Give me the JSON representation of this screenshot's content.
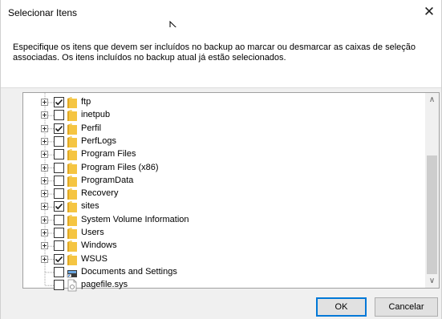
{
  "window": {
    "title": "Selecionar Itens",
    "close_glyph": "✕"
  },
  "description": "Especifique os itens que devem ser incluídos no backup ao marcar ou desmarcar as caixas de seleção associadas. Os itens incluídos no backup atual já estão selecionados.",
  "tree": {
    "items": [
      {
        "label": "ftp",
        "checked": true,
        "expandable": true,
        "icon": "folder-icon"
      },
      {
        "label": "inetpub",
        "checked": false,
        "expandable": true,
        "icon": "folder-icon"
      },
      {
        "label": "Perfil",
        "checked": true,
        "expandable": true,
        "icon": "folder-icon"
      },
      {
        "label": "PerfLogs",
        "checked": false,
        "expandable": true,
        "icon": "folder-icon"
      },
      {
        "label": "Program Files",
        "checked": false,
        "expandable": true,
        "icon": "folder-icon"
      },
      {
        "label": "Program Files (x86)",
        "checked": false,
        "expandable": true,
        "icon": "folder-icon"
      },
      {
        "label": "ProgramData",
        "checked": false,
        "expandable": true,
        "icon": "folder-icon"
      },
      {
        "label": "Recovery",
        "checked": false,
        "expandable": true,
        "icon": "folder-icon"
      },
      {
        "label": "sites",
        "checked": true,
        "expandable": true,
        "icon": "folder-icon"
      },
      {
        "label": "System Volume Information",
        "checked": false,
        "expandable": true,
        "icon": "folder-icon"
      },
      {
        "label": "Users",
        "checked": false,
        "expandable": true,
        "icon": "folder-icon"
      },
      {
        "label": "Windows",
        "checked": false,
        "expandable": true,
        "icon": "folder-icon"
      },
      {
        "label": "WSUS",
        "checked": true,
        "expandable": true,
        "icon": "folder-icon"
      },
      {
        "label": "Documents and Settings",
        "checked": false,
        "expandable": false,
        "icon": "shortcut-icon"
      },
      {
        "label": "pagefile.sys",
        "checked": false,
        "expandable": false,
        "icon": "file-icon"
      }
    ]
  },
  "scrollbar": {
    "up_glyph": "∧",
    "down_glyph": "∨"
  },
  "buttons": {
    "ok_label": "OK",
    "cancel_label": "Cancelar"
  },
  "colors": {
    "folder": "#f5c542",
    "check": "#1a1a1a",
    "focus_border": "#0078d7"
  }
}
